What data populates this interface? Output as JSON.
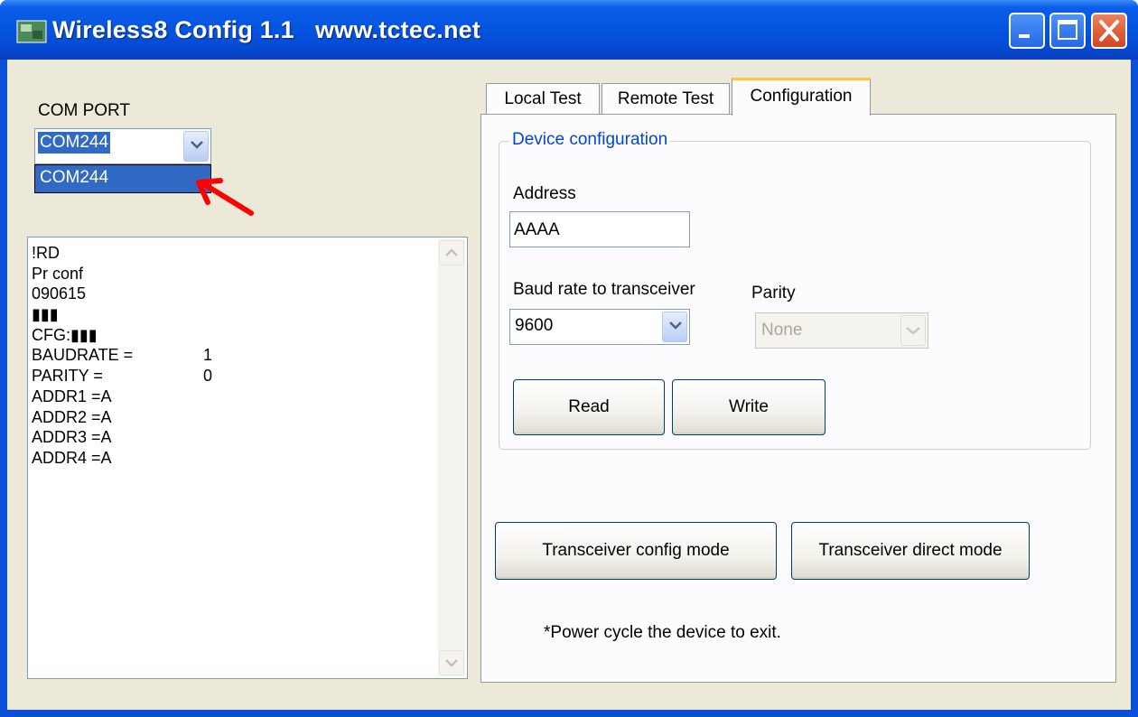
{
  "window": {
    "title": "Wireless8 Config 1.1   www.tctec.net"
  },
  "left": {
    "com_port_label": "COM PORT",
    "com_port_value": "COM244",
    "com_port_dropdown_option": "COM244",
    "log_lines": [
      {
        "text": "!RD",
        "value": ""
      },
      {
        "text": "Pr conf",
        "value": ""
      },
      {
        "text": "090615",
        "value": ""
      },
      {
        "text": "▮▮▮",
        "value": ""
      },
      {
        "text": "CFG:▮▮▮",
        "value": ""
      },
      {
        "text": "BAUDRATE =",
        "value": "1"
      },
      {
        "text": "PARITY =",
        "value": "0"
      },
      {
        "text": "ADDR1 =A",
        "value": ""
      },
      {
        "text": "ADDR2 =A",
        "value": ""
      },
      {
        "text": "ADDR3 =A",
        "value": ""
      },
      {
        "text": "ADDR4 =A",
        "value": ""
      }
    ]
  },
  "tabs": [
    {
      "label": "Local Test",
      "active": false
    },
    {
      "label": "Remote Test",
      "active": false
    },
    {
      "label": "Configuration",
      "active": true
    }
  ],
  "config": {
    "group_title": "Device configuration",
    "address_label": "Address",
    "address_value": "AAAA",
    "baud_label": "Baud rate to transceiver",
    "baud_value": "9600",
    "parity_label": "Parity",
    "parity_value": "None",
    "read_button": "Read",
    "write_button": "Write",
    "config_mode_button": "Transceiver config mode",
    "direct_mode_button": "Transceiver direct mode",
    "note": "*Power cycle the device to exit."
  },
  "colors": {
    "titlebar": "#0554e0",
    "client": "#ece9d8",
    "selection": "#316ac5",
    "group_title": "#0046d5",
    "annotation_arrow": "#ff0000"
  }
}
